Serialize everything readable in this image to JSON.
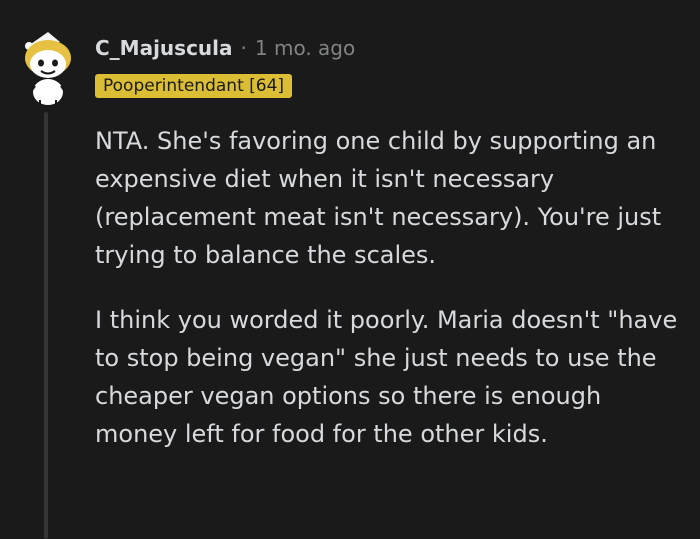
{
  "comment": {
    "author": "C_Majuscula",
    "separator": "·",
    "timestamp": "1 mo. ago",
    "flair": "Pooperintendant [64]",
    "paragraphs": [
      "NTA. She's favoring one child by supporting an expensive diet when it isn't necessary (replacement meat isn't necessary). You're just trying to balance the scales.",
      "I think you worded it poorly. Maria doesn't \"have to stop being vegan\" she just needs to use the cheaper vegan options so there is enough money left for food for the other kids."
    ]
  },
  "icons": {
    "avatar": "snoo-avatar-icon"
  },
  "colors": {
    "background": "#1a1a1b",
    "text": "#d7dadc",
    "muted": "#818384",
    "flair_bg": "#dbbe33",
    "thread_line": "#343536"
  }
}
